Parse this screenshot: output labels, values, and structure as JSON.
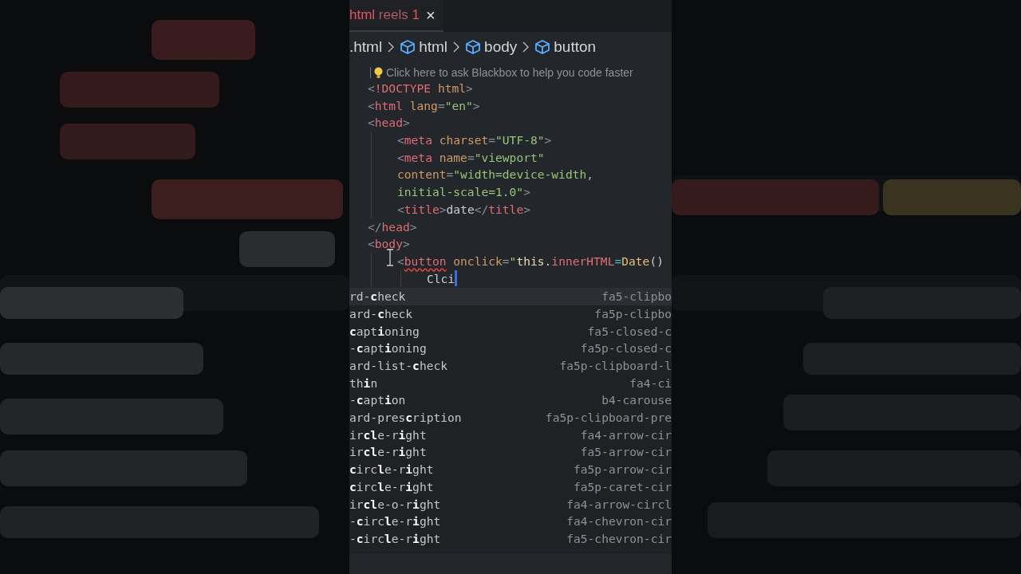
{
  "editor": {
    "tab": {
      "filename": "html",
      "description": "reels",
      "count": "1",
      "close": "×"
    },
    "breadcrumb": [
      {
        "label": ".html",
        "kind": "file"
      },
      {
        "label": "html",
        "kind": "element"
      },
      {
        "label": "body",
        "kind": "element"
      },
      {
        "label": "button",
        "kind": "element"
      }
    ],
    "hint": {
      "text": "Click here to ask Blackbox to help you code faster"
    },
    "code_lines": [
      {
        "tokens": [
          {
            "text": "<",
            "kind": "bracket"
          },
          {
            "text": "!DOCTYPE",
            "kind": "tag"
          },
          {
            "text": " html",
            "kind": "attr"
          },
          {
            "text": ">",
            "kind": "bracket"
          }
        ]
      },
      {
        "tokens": [
          {
            "text": "<",
            "kind": "bracket"
          },
          {
            "text": "html",
            "kind": "tag"
          },
          {
            "text": " lang",
            "kind": "attr"
          },
          {
            "text": "=",
            "kind": "bracket"
          },
          {
            "text": "\"en\"",
            "kind": "string"
          },
          {
            "text": ">",
            "kind": "bracket"
          }
        ]
      },
      {
        "tokens": [
          {
            "text": "<",
            "kind": "bracket"
          },
          {
            "text": "head",
            "kind": "tag"
          },
          {
            "text": ">",
            "kind": "bracket"
          }
        ],
        "children": [
          {
            "tokens": [
              {
                "text": "<",
                "kind": "bracket"
              },
              {
                "text": "meta",
                "kind": "tag"
              },
              {
                "text": " charset",
                "kind": "attr"
              },
              {
                "text": "=",
                "kind": "bracket"
              },
              {
                "text": "\"UTF-8\"",
                "kind": "string"
              },
              {
                "text": ">",
                "kind": "bracket"
              }
            ]
          },
          {
            "tokens": [
              {
                "text": "<",
                "kind": "bracket"
              },
              {
                "text": "meta",
                "kind": "tag"
              },
              {
                "text": " name",
                "kind": "attr"
              },
              {
                "text": "=",
                "kind": "bracket"
              },
              {
                "text": "\"viewport\"",
                "kind": "string"
              }
            ]
          },
          {
            "tokens": [
              {
                "text": "content",
                "kind": "attr"
              },
              {
                "text": "=",
                "kind": "bracket"
              },
              {
                "text": "\"width=device-width,",
                "kind": "string"
              }
            ]
          },
          {
            "tokens": [
              {
                "text": "initial-scale=1.0\"",
                "kind": "string"
              },
              {
                "text": ">",
                "kind": "bracket"
              }
            ]
          },
          {
            "tokens": [
              {
                "text": "<",
                "kind": "bracket"
              },
              {
                "text": "title",
                "kind": "tag"
              },
              {
                "text": ">",
                "kind": "bracket"
              },
              {
                "text": "date",
                "kind": "text"
              },
              {
                "text": "</",
                "kind": "bracket"
              },
              {
                "text": "title",
                "kind": "tag"
              },
              {
                "text": ">",
                "kind": "bracket"
              }
            ]
          }
        ]
      },
      {
        "tokens": [
          {
            "text": "</",
            "kind": "bracket"
          },
          {
            "text": "head",
            "kind": "tag"
          },
          {
            "text": ">",
            "kind": "bracket"
          }
        ]
      },
      {
        "tokens": [
          {
            "text": "<",
            "kind": "bracket"
          },
          {
            "text": "body",
            "kind": "tag"
          },
          {
            "text": ">",
            "kind": "bracket"
          }
        ],
        "children": [
          {
            "tokens": [
              {
                "text": "<",
                "kind": "bracket"
              },
              {
                "text": "button",
                "kind": "tag",
                "error": true
              },
              {
                "text": " onclick",
                "kind": "attr"
              },
              {
                "text": "=",
                "kind": "bracket"
              },
              {
                "text": "\"",
                "kind": "string"
              },
              {
                "text": "this",
                "kind": "variable"
              },
              {
                "text": ".",
                "kind": "text"
              },
              {
                "text": "innerHTML",
                "kind": "tag"
              },
              {
                "text": "=",
                "kind": "operator"
              },
              {
                "text": "Date",
                "kind": "function"
              },
              {
                "text": "()",
                "kind": "text"
              }
            ],
            "children": [
              {
                "tokens": [
                  {
                    "text": "Clci",
                    "kind": "text"
                  }
                ],
                "caret": true
              }
            ]
          }
        ]
      }
    ],
    "suggestions": [
      {
        "label": "rd-**c**heck",
        "detail": "fa5-clipbo",
        "selected": true
      },
      {
        "label": "ard-**c**heck",
        "detail": "fa5p-clipbo",
        "selected": false
      },
      {
        "label": "**c**apt**i**oning",
        "detail": "fa5-closed-c",
        "selected": false
      },
      {
        "label": "-**c**apt**i**oning",
        "detail": "fa5p-closed-c",
        "selected": false
      },
      {
        "label": "ard-list-**c**heck",
        "detail": "fa5p-clipboard-l",
        "selected": false
      },
      {
        "label": "th**i**n",
        "detail": "fa4-ci",
        "selected": false
      },
      {
        "label": "-**c**apt**i**on",
        "detail": "b4-carouse",
        "selected": false
      },
      {
        "label": "ard-pres**c**ription",
        "detail": "fa5p-clipboard-pre",
        "selected": false
      },
      {
        "label": "ir**cl**e-r**i**ght",
        "detail": "fa4-arrow-cir",
        "selected": false
      },
      {
        "label": "ir**cl**e-r**i**ght",
        "detail": "fa5-arrow-cir",
        "selected": false
      },
      {
        "label": "**c**irc**l**e-r**i**ght",
        "detail": "fa5p-arrow-cir",
        "selected": false
      },
      {
        "label": "**c**irc**l**e-r**i**ght",
        "detail": "fa5p-caret-cir",
        "selected": false
      },
      {
        "label": "ir**cl**e-o-r**i**ght",
        "detail": "fa4-arrow-circl",
        "selected": false
      },
      {
        "label": "-**c**irc**l**e-r**i**ght",
        "detail": "fa4-chevron-cir",
        "selected": false
      },
      {
        "label": "-**c**irc**l**e-r**i**ght",
        "detail": "fa5-chevron-cir",
        "selected": false
      }
    ]
  }
}
